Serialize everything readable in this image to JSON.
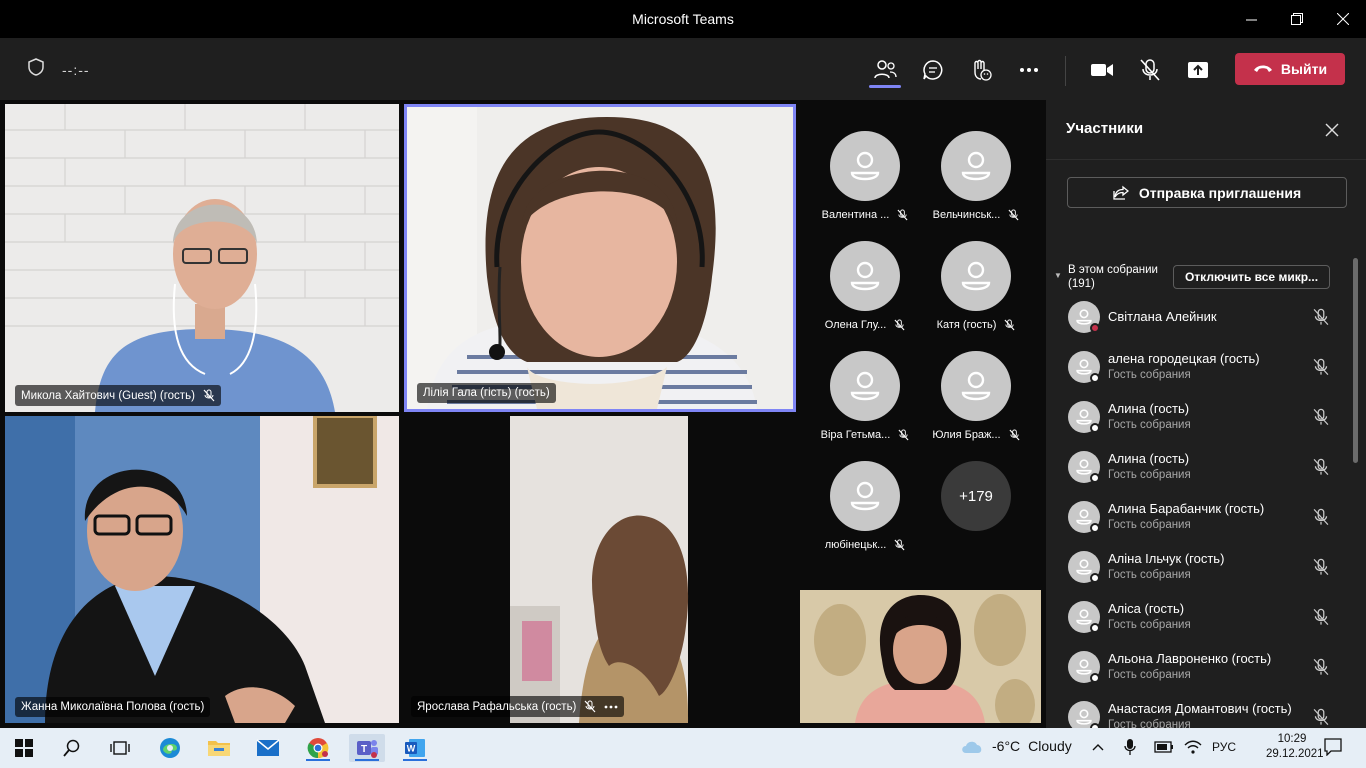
{
  "window": {
    "title": "Microsoft Teams"
  },
  "toolbar": {
    "timer": "--:--",
    "leave_label": "Выйти"
  },
  "tiles": {
    "t1": "Микола Хайтович (Guest) (гость)",
    "t2": "Лілія Гала (гість) (гость)",
    "t3": "Жанна Миколаївна Полова (гость)",
    "t4": "Ярослава Рафальська (гость)"
  },
  "grid": {
    "people": [
      {
        "name": "Валентина ..."
      },
      {
        "name": "Вельчинськ..."
      },
      {
        "name": "Олена Глу..."
      },
      {
        "name": "Катя (гость)"
      },
      {
        "name": "Віра Гетьма..."
      },
      {
        "name": "Юлия Браж..."
      },
      {
        "name": "любінецьк..."
      }
    ],
    "more": "+179"
  },
  "participants": {
    "title": "Участники",
    "invite": "Отправка приглашения",
    "section": "В этом собрании",
    "count": "(191)",
    "mute_all": "Отключить все микр...",
    "list": [
      {
        "name": "Світлана Алейник",
        "sub": ""
      },
      {
        "name": "алена городецкая (гость)",
        "sub": "Гость собрания"
      },
      {
        "name": "Алина (гость)",
        "sub": "Гость собрания"
      },
      {
        "name": "Алина (гость)",
        "sub": "Гость собрания"
      },
      {
        "name": "Алина Барабанчик (гость)",
        "sub": "Гость собрания"
      },
      {
        "name": "Аліна Ільчук (гость)",
        "sub": "Гость собрания"
      },
      {
        "name": "Аліса (гость)",
        "sub": "Гость собрания"
      },
      {
        "name": "Альона Лавроненко (гость)",
        "sub": "Гость собрания"
      },
      {
        "name": "Анастасия Домантович (гость)",
        "sub": "Гость собрания"
      }
    ]
  },
  "taskbar": {
    "temp": "-6°C",
    "weather": "Cloudy",
    "lang": "РУС",
    "time": "10:29",
    "date": "29.12.2021"
  },
  "colors": {
    "accent": "#7f85f5",
    "leave": "#c4314b",
    "panel": "#1f1f1f"
  }
}
